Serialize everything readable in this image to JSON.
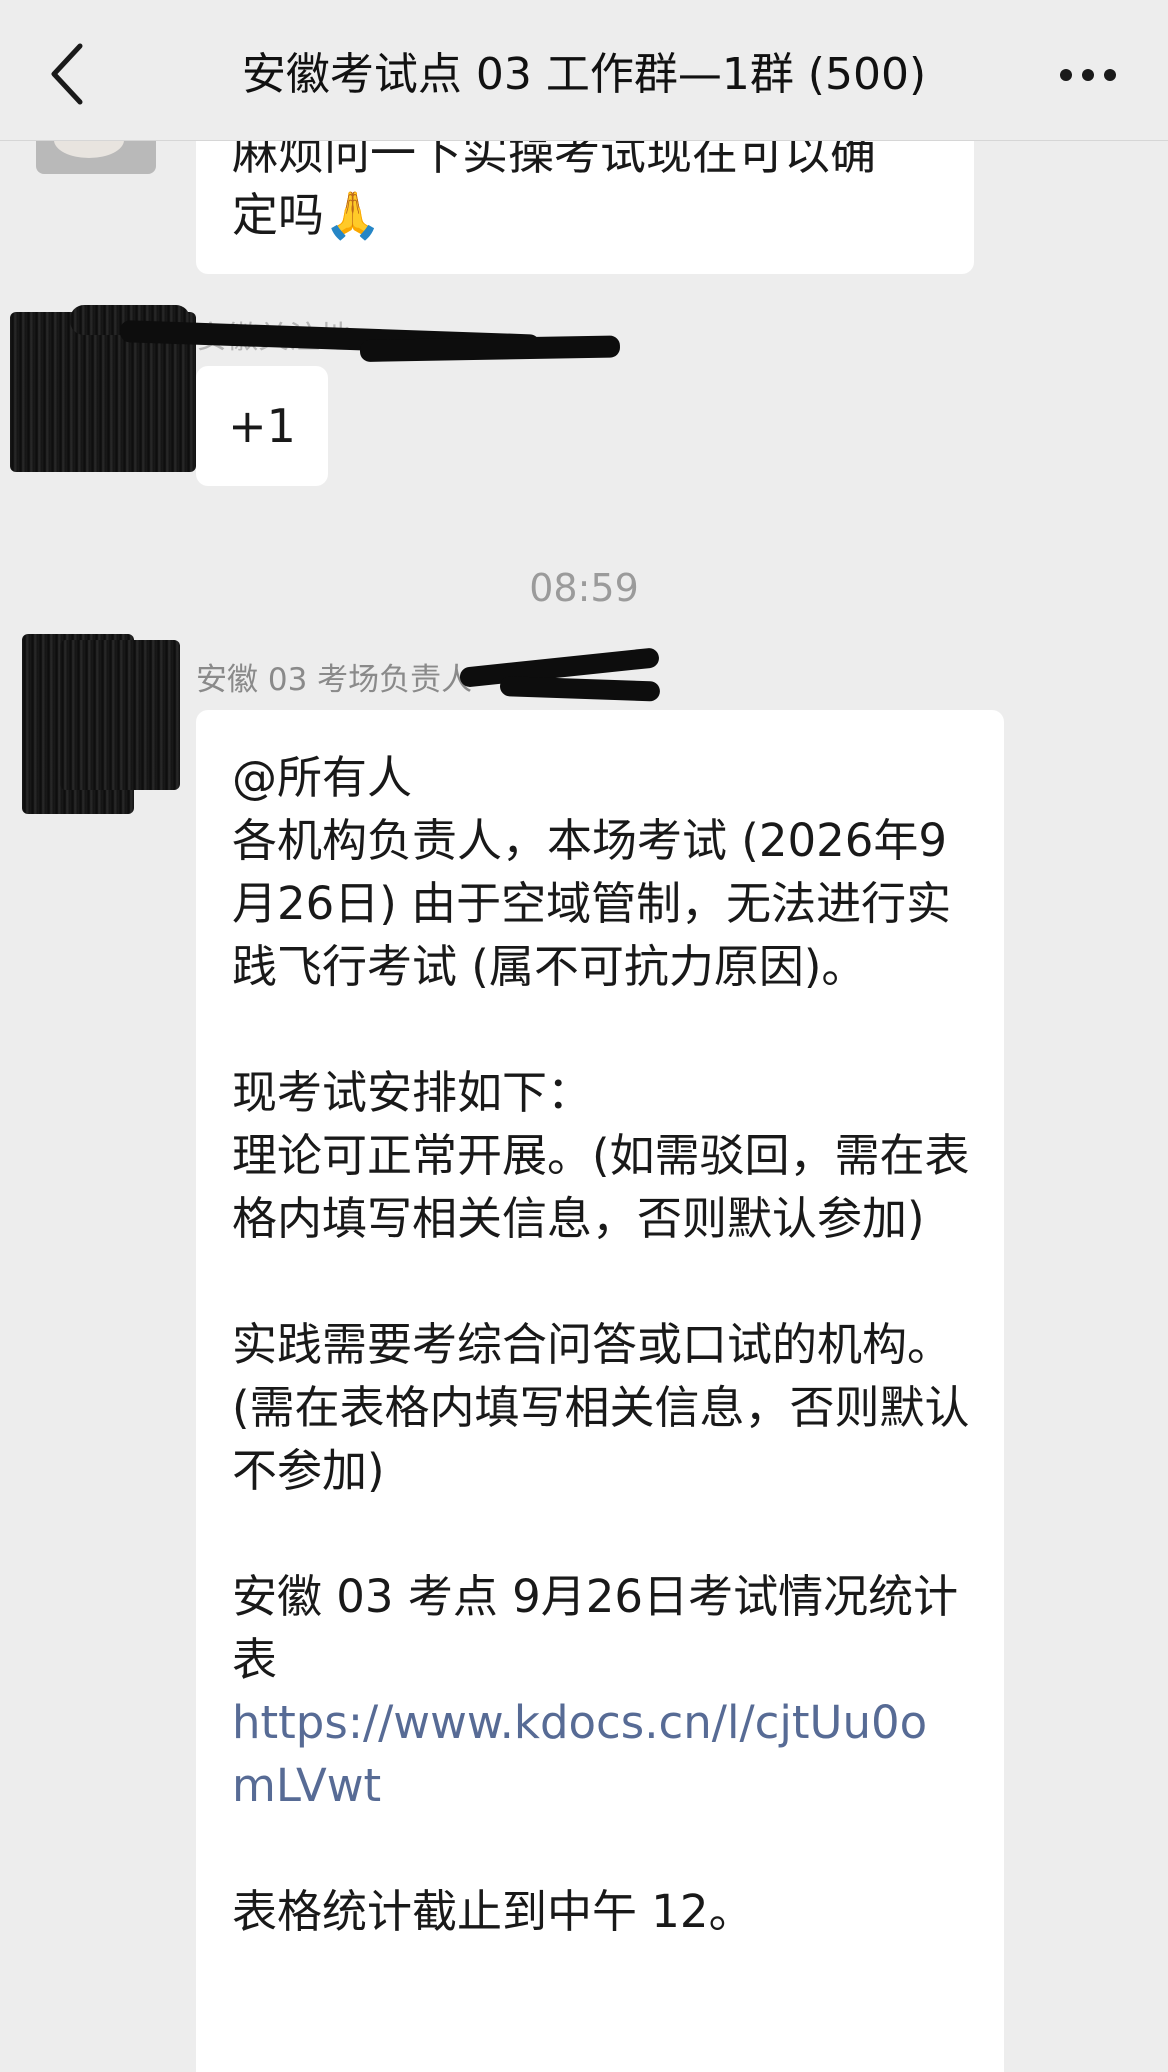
{
  "header": {
    "title": "安徽考试点 03 工作群—1群 (500)",
    "back_icon": "chevron-left-icon",
    "more_icon": "more-dots-icon"
  },
  "messages": [
    {
      "text_line1": "麻烦问一下实操考试现在可以确",
      "text_line2": "定吗🙏"
    },
    {
      "sender": "安徽关注地…",
      "text": "+1"
    }
  ],
  "timestamp": "08:59",
  "announcement": {
    "sender": "安徽 03 考场负责人",
    "body_before_link": "@所有人\n各机构负责人，本场考试 (2026年9月26日) 由于空域管制，无法进行实践飞行考试 (属不可抗力原因)。\n\n现考试安排如下：\n理论可正常开展。(如需驳回，需在表格内填写相关信息，否则默认参加)\n\n实践需要考综合问答或口试的机构。(需在表格内填写相关信息，否则默认不参加)\n\n安徽 03 考点 9月26日考试情况统计表\n",
    "link": "https://www.kdocs.cn/l/cjtUu0omLVwt",
    "body_after_link": "\n\n表格统计截止到中午 12。"
  },
  "colors": {
    "background": "#ededed",
    "bubble": "#ffffff",
    "link": "#576b95",
    "meta_text": "#9b9b9b"
  }
}
